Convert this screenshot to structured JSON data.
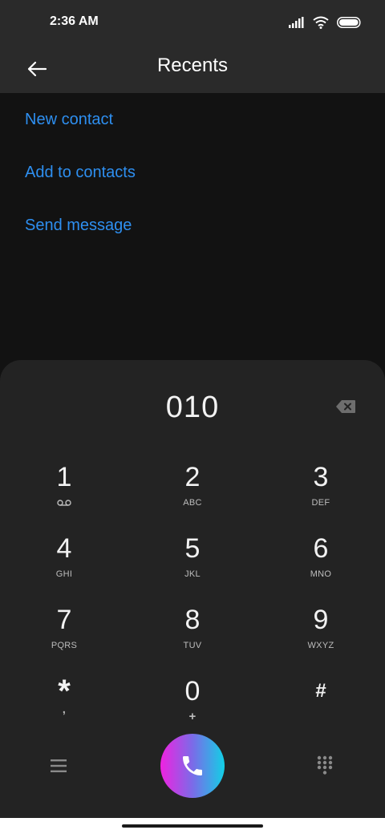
{
  "status_bar": {
    "time": "2:36 AM",
    "icons": [
      "signal-icon",
      "wifi-icon",
      "battery-icon"
    ]
  },
  "app_bar": {
    "title": "Recents",
    "back_icon": "arrow-left-icon"
  },
  "actions": [
    {
      "label": "New contact"
    },
    {
      "label": "Add to contacts"
    },
    {
      "label": "Send message"
    }
  ],
  "dialer": {
    "number": "010",
    "backspace_icon": "backspace-icon",
    "keys": [
      {
        "digit": "1",
        "letters": ""
      },
      {
        "digit": "2",
        "letters": "ABC"
      },
      {
        "digit": "3",
        "letters": "DEF"
      },
      {
        "digit": "4",
        "letters": "GHI"
      },
      {
        "digit": "5",
        "letters": "JKL"
      },
      {
        "digit": "6",
        "letters": "MNO"
      },
      {
        "digit": "7",
        "letters": "PQRS"
      },
      {
        "digit": "8",
        "letters": "TUV"
      },
      {
        "digit": "9",
        "letters": "WXYZ"
      },
      {
        "digit": "*",
        "letters": ","
      },
      {
        "digit": "0",
        "letters": "+"
      },
      {
        "digit": "#",
        "letters": ""
      }
    ]
  },
  "colors": {
    "accent": "#2e8ff0",
    "background": "#121212",
    "surface": "#232323",
    "bar": "#2a2a2a"
  },
  "bottom_bar": {
    "menu_icon": "menu-icon",
    "call_icon": "phone-icon",
    "keypad_icon": "dialpad-icon"
  }
}
